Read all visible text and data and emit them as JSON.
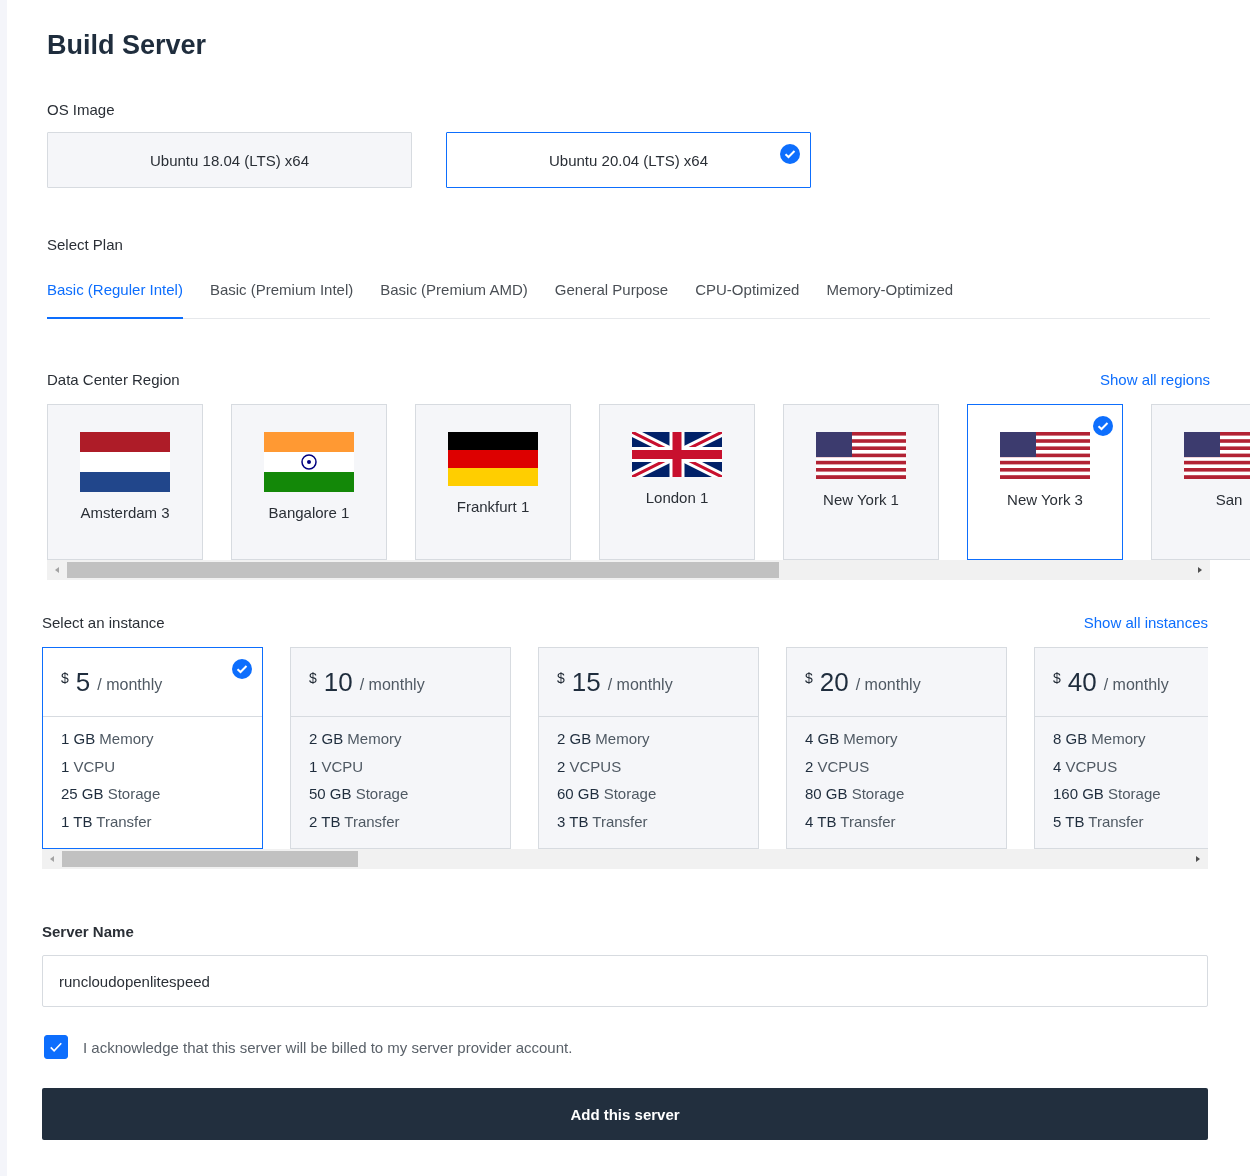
{
  "title": "Build Server",
  "os_image": {
    "label": "OS Image",
    "options": [
      {
        "label": "Ubuntu 18.04 (LTS) x64",
        "selected": false
      },
      {
        "label": "Ubuntu 20.04 (LTS) x64",
        "selected": true
      }
    ]
  },
  "plan": {
    "label": "Select Plan",
    "tabs": [
      {
        "label": "Basic (Reguler Intel)",
        "selected": true
      },
      {
        "label": "Basic (Premium Intel)",
        "selected": false
      },
      {
        "label": "Basic (Premium AMD)",
        "selected": false
      },
      {
        "label": "General Purpose",
        "selected": false
      },
      {
        "label": "CPU-Optimized",
        "selected": false
      },
      {
        "label": "Memory-Optimized",
        "selected": false
      }
    ]
  },
  "region": {
    "label": "Data Center Region",
    "link": "Show all regions",
    "items": [
      {
        "name": "Amsterdam 3",
        "kind": "nl",
        "selected": false
      },
      {
        "name": "Bangalore 1",
        "kind": "in",
        "selected": false
      },
      {
        "name": "Frankfurt 1",
        "kind": "de",
        "selected": false
      },
      {
        "name": "London 1",
        "kind": "gb",
        "selected": false
      },
      {
        "name": "New York 1",
        "kind": "us",
        "selected": false
      },
      {
        "name": "New York 3",
        "kind": "us",
        "selected": true
      },
      {
        "name": "San",
        "kind": "us",
        "selected": false
      }
    ]
  },
  "instance": {
    "label": "Select an instance",
    "link": "Show all instances",
    "items": [
      {
        "currency": "$",
        "price": "5",
        "period": "/ monthly",
        "selected": true,
        "specs": [
          "**1 GB** Memory",
          "**1** VCPU",
          "**25 GB** Storage",
          "**1 TB** Transfer"
        ]
      },
      {
        "currency": "$",
        "price": "10",
        "period": "/ monthly",
        "selected": false,
        "specs": [
          "**2 GB** Memory",
          "**1** VCPU",
          "**50 GB** Storage",
          "**2 TB** Transfer"
        ]
      },
      {
        "currency": "$",
        "price": "15",
        "period": "/ monthly",
        "selected": false,
        "specs": [
          "**2 GB** Memory",
          "**2** VCPUS",
          "**60 GB** Storage",
          "**3 TB** Transfer"
        ]
      },
      {
        "currency": "$",
        "price": "20",
        "period": "/ monthly",
        "selected": false,
        "specs": [
          "**4 GB** Memory",
          "**2** VCPUS",
          "**80 GB** Storage",
          "**4 TB** Transfer"
        ]
      },
      {
        "currency": "$",
        "price": "40",
        "period": "/ monthly",
        "selected": false,
        "specs": [
          "**8 GB** Memory",
          "**4** VCPUS",
          "**160 GB** Storage",
          "**5 TB** Transfer"
        ]
      }
    ]
  },
  "server_name": {
    "label": "Server Name",
    "value": "runcloudopenlitespeed"
  },
  "acknowledge": {
    "label": "I acknowledge that this server will be billed to my server provider account.",
    "checked": true
  },
  "submit": "Add this server"
}
